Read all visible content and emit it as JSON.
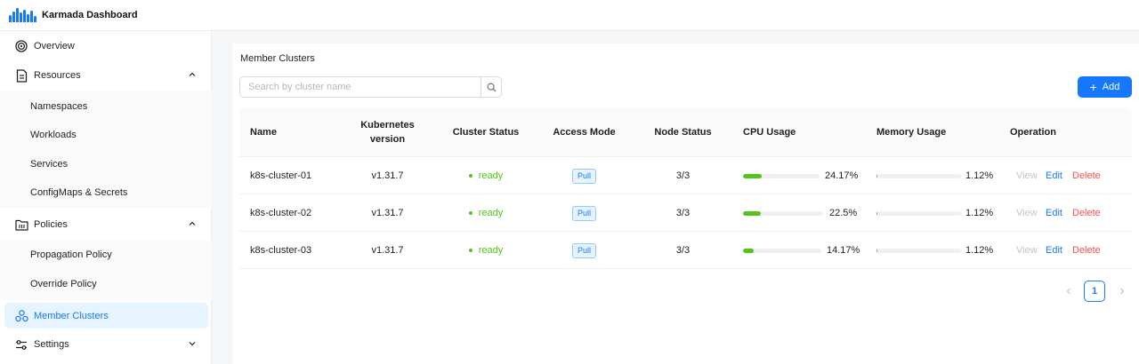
{
  "app": {
    "title": "Karmada Dashboard",
    "logo": "karmada-logo"
  },
  "sidebar": {
    "items": [
      {
        "label": "Overview",
        "icon": "target-icon"
      },
      {
        "label": "Resources",
        "icon": "document-icon",
        "expanded": true,
        "children": [
          "Namespaces",
          "Workloads",
          "Services",
          "ConfigMaps & Secrets"
        ]
      },
      {
        "label": "Policies",
        "icon": "policy-icon",
        "expanded": true,
        "children": [
          "Propagation Policy",
          "Override Policy"
        ]
      },
      {
        "label": "Member Clusters",
        "icon": "clusters-icon",
        "active": true
      },
      {
        "label": "Settings",
        "icon": "sliders-icon",
        "expanded": false
      }
    ]
  },
  "main": {
    "section_title": "Member Clusters",
    "search": {
      "placeholder": "Search by cluster name",
      "value": ""
    },
    "add_button": {
      "label": "Add",
      "icon": "plus-icon"
    },
    "table": {
      "columns": [
        "Name",
        "Kubernetes version",
        "Cluster Status",
        "Access Mode",
        "Node Status",
        "CPU Usage",
        "Memory Usage",
        "Operation"
      ],
      "rows": [
        {
          "name": "k8s-cluster-01",
          "version": "v1.31.7",
          "status": "ready",
          "access_mode": "Pull",
          "node_status": "3/3",
          "cpu_label": "24.17%",
          "cpu_percent": 24.17,
          "mem_label": "1.12%",
          "mem_percent": 1.12
        },
        {
          "name": "k8s-cluster-02",
          "version": "v1.31.7",
          "status": "ready",
          "access_mode": "Pull",
          "node_status": "3/3",
          "cpu_label": "22.5%",
          "cpu_percent": 22.5,
          "mem_label": "1.12%",
          "mem_percent": 1.12
        },
        {
          "name": "k8s-cluster-03",
          "version": "v1.31.7",
          "status": "ready",
          "access_mode": "Pull",
          "node_status": "3/3",
          "cpu_label": "14.17%",
          "cpu_percent": 14.17,
          "mem_label": "1.12%",
          "mem_percent": 1.12
        }
      ],
      "operations": {
        "view": "View",
        "edit": "Edit",
        "delete": "Delete"
      }
    },
    "pagination": {
      "current_page": "1"
    }
  },
  "colors": {
    "accent": "#1677ff",
    "success": "#52c41a",
    "danger": "#ff4d4f",
    "disabled": "#c4c4c4"
  }
}
